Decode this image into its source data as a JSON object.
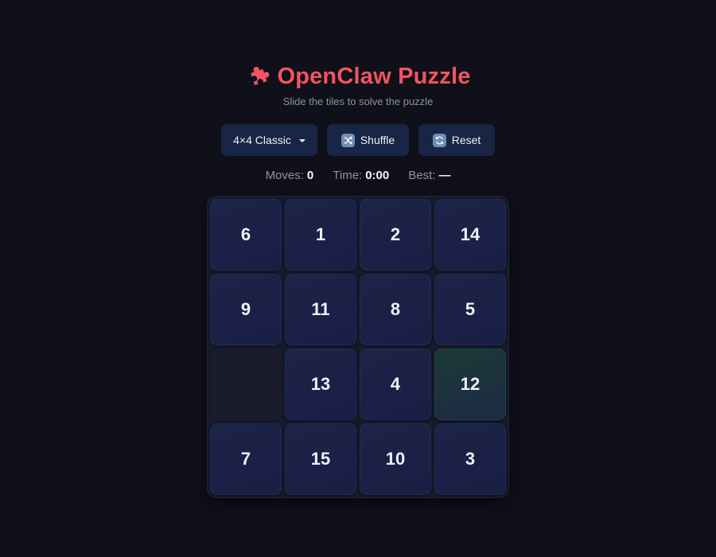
{
  "header": {
    "title": "OpenClaw Puzzle",
    "subtitle": "Slide the tiles to solve the puzzle",
    "icon": "puzzle-piece-icon",
    "accent_color": "#f2545f"
  },
  "controls": {
    "size_select": {
      "selected": "4×4 Classic"
    },
    "shuffle_label": "Shuffle",
    "reset_label": "Reset"
  },
  "stats": {
    "moves_label": "Moves:",
    "moves_value": "0",
    "time_label": "Time:",
    "time_value": "0:00",
    "best_label": "Best:",
    "best_value": "—"
  },
  "board": {
    "rows": 4,
    "cols": 4,
    "tiles": [
      [
        "6",
        "1",
        "2",
        "14"
      ],
      [
        "9",
        "11",
        "8",
        "5"
      ],
      [
        "",
        "13",
        "4",
        "12"
      ],
      [
        "7",
        "15",
        "10",
        "3"
      ]
    ],
    "correct_tiles": [
      "12"
    ]
  }
}
